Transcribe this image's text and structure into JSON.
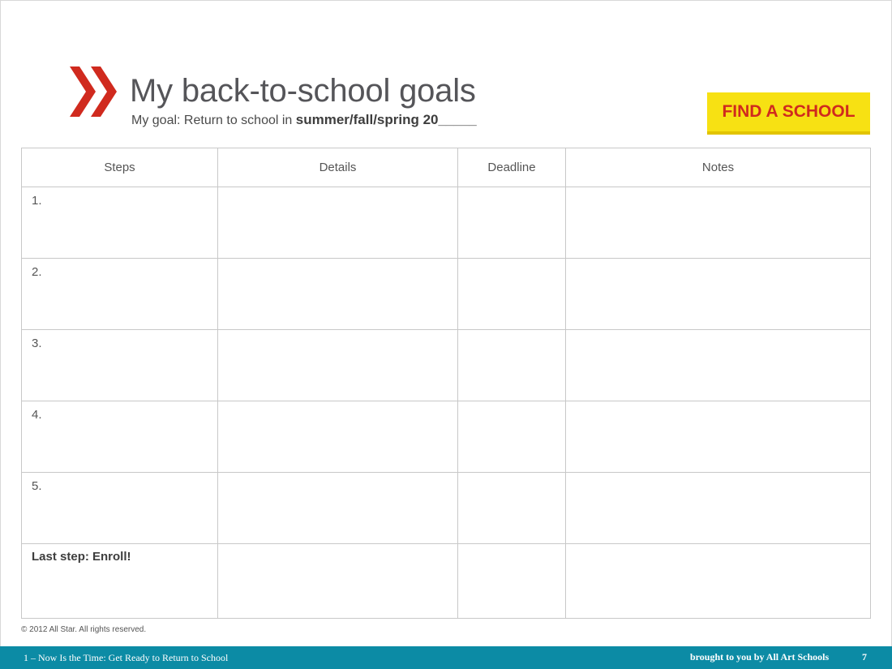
{
  "header": {
    "title": "My back-to-school goals",
    "subtitle_prefix": "My goal: Return to school in ",
    "subtitle_bold": "summer/fall/spring 20_____"
  },
  "find_school_button": {
    "label": "FIND A SCHOOL"
  },
  "table": {
    "columns": [
      "Steps",
      "Details",
      "Deadline",
      "Notes"
    ],
    "rows": [
      "1.",
      "2.",
      "3.",
      "4.",
      "5.",
      "Last step: Enroll!"
    ]
  },
  "copyright": "© 2012 All Star. All rights reserved.",
  "footer": {
    "left": "1 – Now Is the Time: Get Ready to Return to School",
    "right": "brought to you by All Art Schools",
    "page_number": "7"
  },
  "colors": {
    "accent_red": "#d02a1e",
    "button_yellow": "#f7e113",
    "footer_teal": "#0c8ba5"
  }
}
